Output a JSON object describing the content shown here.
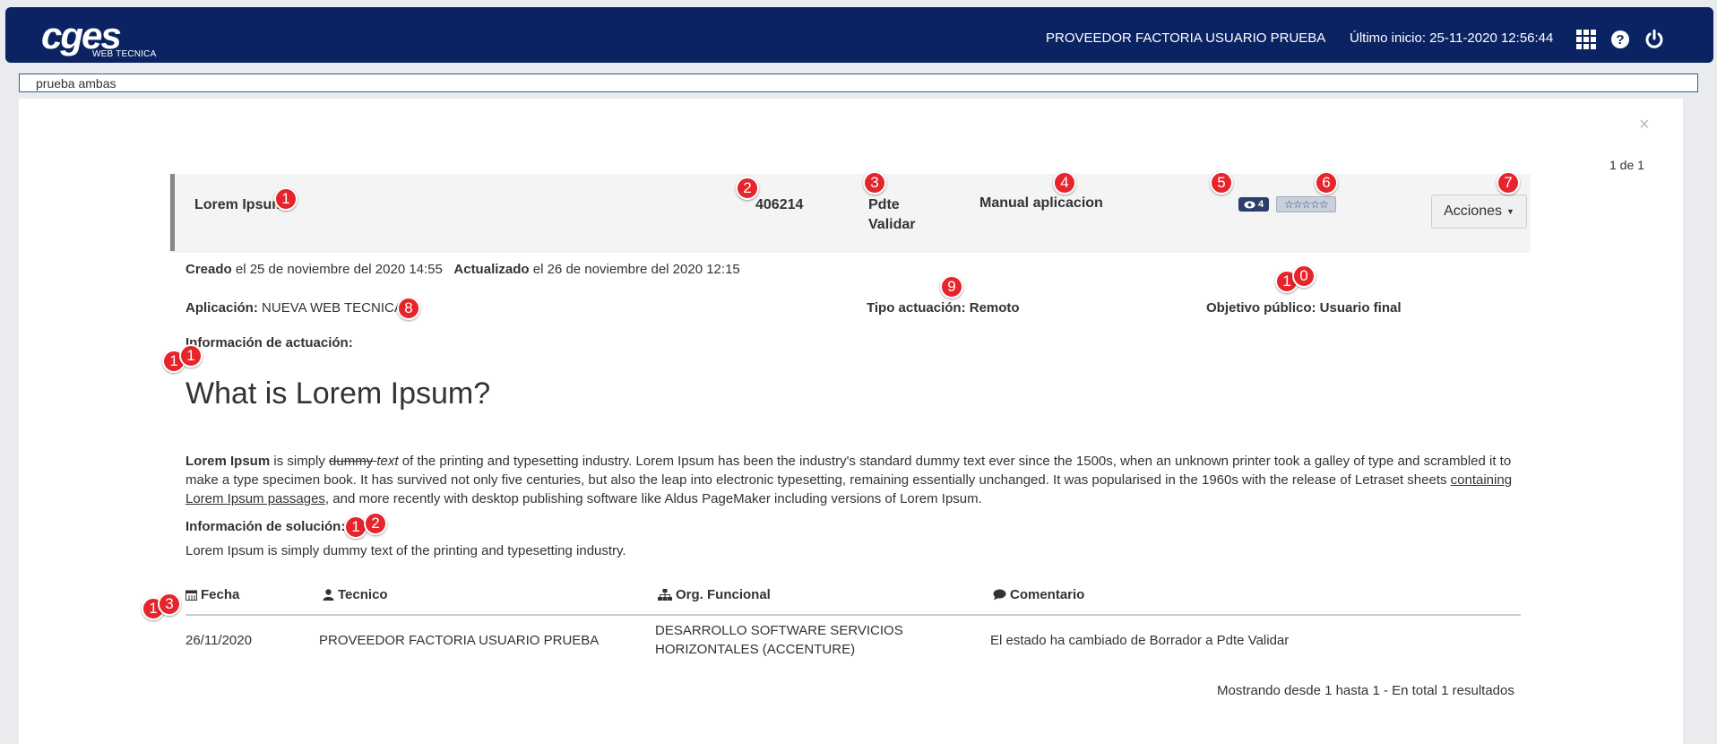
{
  "header": {
    "logo_text": "cges",
    "logo_sub": "WEB TECNICA",
    "user": "PROVEEDOR FACTORIA USUARIO PRUEBA",
    "last_login": "Último inicio: 25-11-2020 12:56:44",
    "icons": [
      "apps-grid-icon",
      "help-icon",
      "power-icon"
    ]
  },
  "search": {
    "value": "prueba ambas"
  },
  "pager": "1 de 1",
  "close_symbol": "×",
  "card": {
    "title": "Lorem Ipsum",
    "number": "406214",
    "state": "Pdte Validar",
    "type": "Manual aplicacion",
    "views": "4",
    "stars": "☆☆☆☆☆",
    "actions_label": "Acciones"
  },
  "meta": {
    "created_label": "Creado",
    "created_value": "el 25 de noviembre del 2020 14:55",
    "updated_label": "Actualizado",
    "updated_value": "el 26 de noviembre del 2020 12:15"
  },
  "details": {
    "app_label": "Aplicación:",
    "app_value": "NUEVA WEB TECNICA",
    "tipo": "Tipo actuación: Remoto",
    "objetivo": "Objetivo público: Usuario final"
  },
  "actuacion": {
    "heading": "Información de actuación:",
    "title": "What is Lorem Ipsum?",
    "p_bold": "Lorem Ipsum",
    "p_1": " is simply ",
    "p_strike": "dummy ",
    "p_italic": "text",
    "p_2": " of the printing and typesetting industry. Lorem Ipsum has been the industry's standard dummy text ever since the 1500s, when an unknown printer took a galley of type and scrambled it to make a type specimen book. It has survived not only five centuries, but also the leap into electronic typesetting, remaining essentially unchanged. It was popularised in the 1960s with the release of Letraset sheets ",
    "p_link": "containing Lorem Ipsum passages",
    "p_3": ", and more recently with desktop publishing software like Aldus PageMaker including versions of Lorem Ipsum."
  },
  "solucion": {
    "heading": "Información de solución:",
    "text": "Lorem Ipsum is simply dummy text of the printing and typesetting industry."
  },
  "table": {
    "headers": [
      "Fecha",
      "Tecnico",
      "Org. Funcional",
      "Comentario"
    ],
    "rows": [
      {
        "fecha": "26/11/2020",
        "tecnico": "PROVEEDOR FACTORIA USUARIO PRUEBA",
        "org_1": "DESARROLLO SOFTWARE SERVICIOS",
        "org_2": "HORIZONTALES (ACCENTURE)",
        "comentario": "El estado ha cambiado de Borrador a Pdte Validar"
      }
    ]
  },
  "footer": "Mostrando desde 1 hasta 1 - En total 1 resultados",
  "markers": [
    "1",
    "2",
    "3",
    "4",
    "5",
    "6",
    "7",
    "8",
    "9",
    "1",
    "0",
    "1",
    "1",
    "1",
    "2",
    "1",
    "3"
  ],
  "colors": {
    "header_bg": "#0b2362",
    "marker": "#e5242b"
  }
}
